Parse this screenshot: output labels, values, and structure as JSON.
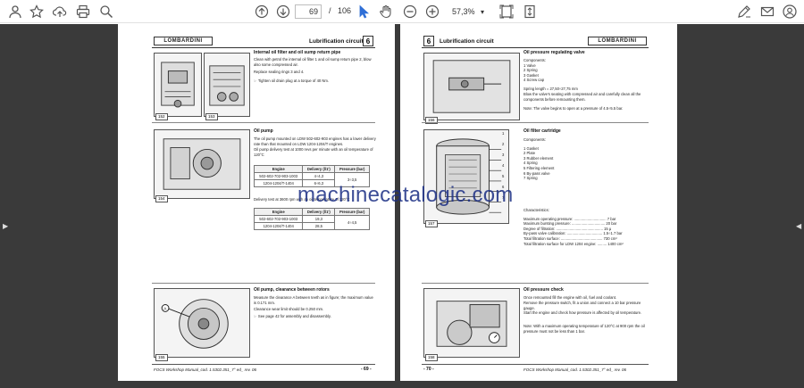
{
  "toolbar": {
    "current_page": "69",
    "page_separator": "/",
    "total_pages": "106",
    "zoom": "57,3%",
    "zoom_arrow": "▾"
  },
  "left_page": {
    "logo": "LOMBARDINI",
    "header_title": "Lubrification circuit",
    "header_num": "6",
    "sec1_title": "Internal oil filter and oil sump return pipe",
    "sec1_p1": "Clean with petrol the internal oil filter 1 and oil sump return pipe 2, blow also some compressed air.",
    "sec1_p2": "Replace sealing rings 3 and 4.",
    "sec1_p3": "Tighten oil drain plug at a torque of 40 Nm.",
    "fig1_tag": "152",
    "fig2_tag": "153",
    "sec2_title": "Oil pump",
    "sec2_p1": "The oil pump mounted on LDW 502-602-903 engines has a lower delivery rate than that mounted on LDW 1204-1204/T engines.",
    "sec2_p2": "Oil pump delivery test at 1000 revs per minute with an oil temperature of 120°C",
    "fig3_tag": "154",
    "table1": {
      "headers": [
        "Engine",
        "Delivery (l/1')",
        "Pressure (bar)"
      ],
      "rows": [
        [
          "502-602-702-903-1003",
          "4÷4,3",
          "3÷3,5"
        ],
        [
          "1204-1204/T-1404",
          "6÷6,3",
          ""
        ]
      ]
    },
    "sec2_p3": "Delivery test at 3600 rpm with an oil temperature of 120°C",
    "table2": {
      "headers": [
        "Engine",
        "Delivery (l/1')",
        "Pressure (bar)"
      ],
      "rows": [
        [
          "502-602-702-903-1003",
          "19,3",
          "4÷4,5"
        ],
        [
          "1204-1204/T-1404",
          "28,5",
          ""
        ]
      ]
    },
    "sec3_title": "Oil pump, clearance between rotors",
    "sec3_p1": "Measure the clearance A between teeth as in figure; the maximum value is 0.171 mm.",
    "sec3_p2": "Clearance wear limit should be 0.250 mm.",
    "sec3_p3": "See page 42 for assembly and disassembly.",
    "fig4_tag": "155",
    "footer": "FOCS Workshop Manual_cod. 1.5302.351_7° ed_ rev. 06",
    "page_number": "- 69 -"
  },
  "right_page": {
    "logo": "LOMBARDINI",
    "header_title": "Lubrification circuit",
    "header_num": "6",
    "sec1_title": "Oil pressure regulating valve",
    "sec1_components_label": "Components:",
    "sec1_components": [
      "1 Valve",
      "2 Spring",
      "3 Gasket",
      "4 Screw cap"
    ],
    "sec1_p1": "Spring length = 27,50÷27,75 mm",
    "sec1_p2": "Blow the valve's seating with compressed air and carefully clean all the components before remounting them.",
    "sec1_note": "Note: The valve begins to open at a pressure of 4.5÷5.5 bar.",
    "fig1_tag": "156",
    "sec2_title": "Oil filter cartridge",
    "sec2_components_label": "Components:",
    "sec2_components": [
      "1 Gasket",
      "2 Plate",
      "3 Rubber element",
      "4 Spring",
      "5 Filtering element",
      "6 By-pass valve",
      "7 Spring"
    ],
    "sec2_char_label": "Characteristics:",
    "sec2_chars": [
      "Maximum operating pressure: ............................... 7 bar",
      "Maximum bursting pressure: ................................ 20 bar",
      "Degree of filtration: ............................................. 15 μ",
      "By-pass valve calibration: .................................. 1.5÷1.7 bar",
      "Total filtration surface: ........................................ 730 cm²",
      "Total filtration surface for LDW 1204 engine: ......... 1400 cm²"
    ],
    "fig2_tag": "157",
    "fig2_labels": [
      "1",
      "2",
      "3",
      "4",
      "5",
      "6",
      "7"
    ],
    "sec3_title": "Oil pressure check",
    "sec3_p1": "Once remounted fill the engine with oil, fuel and coolant.",
    "sec3_p2": "Remove the pressure switch, fit a union and connect a 10 bar pressure gauge.",
    "sec3_p3": "Start the engine and check how pressure is affected by oil temperature.",
    "sec3_note": "Note: With a maximum operating temperature of 120°C at 900 rpm the oil pressure must not be less than 1 bar.",
    "fig3_tag": "158",
    "footer": "FOCS Workshop Manual_cod. 1.5302.351_7° ed_ rev. 06",
    "page_number": "- 70 -"
  },
  "watermark": "machinecatalogic.com",
  "colors": {
    "toolbar_bg": "#ffffff",
    "viewer_bg": "#3a3a3a",
    "watermark": "#1b2e84",
    "active_tool": "#2f6fd6"
  }
}
